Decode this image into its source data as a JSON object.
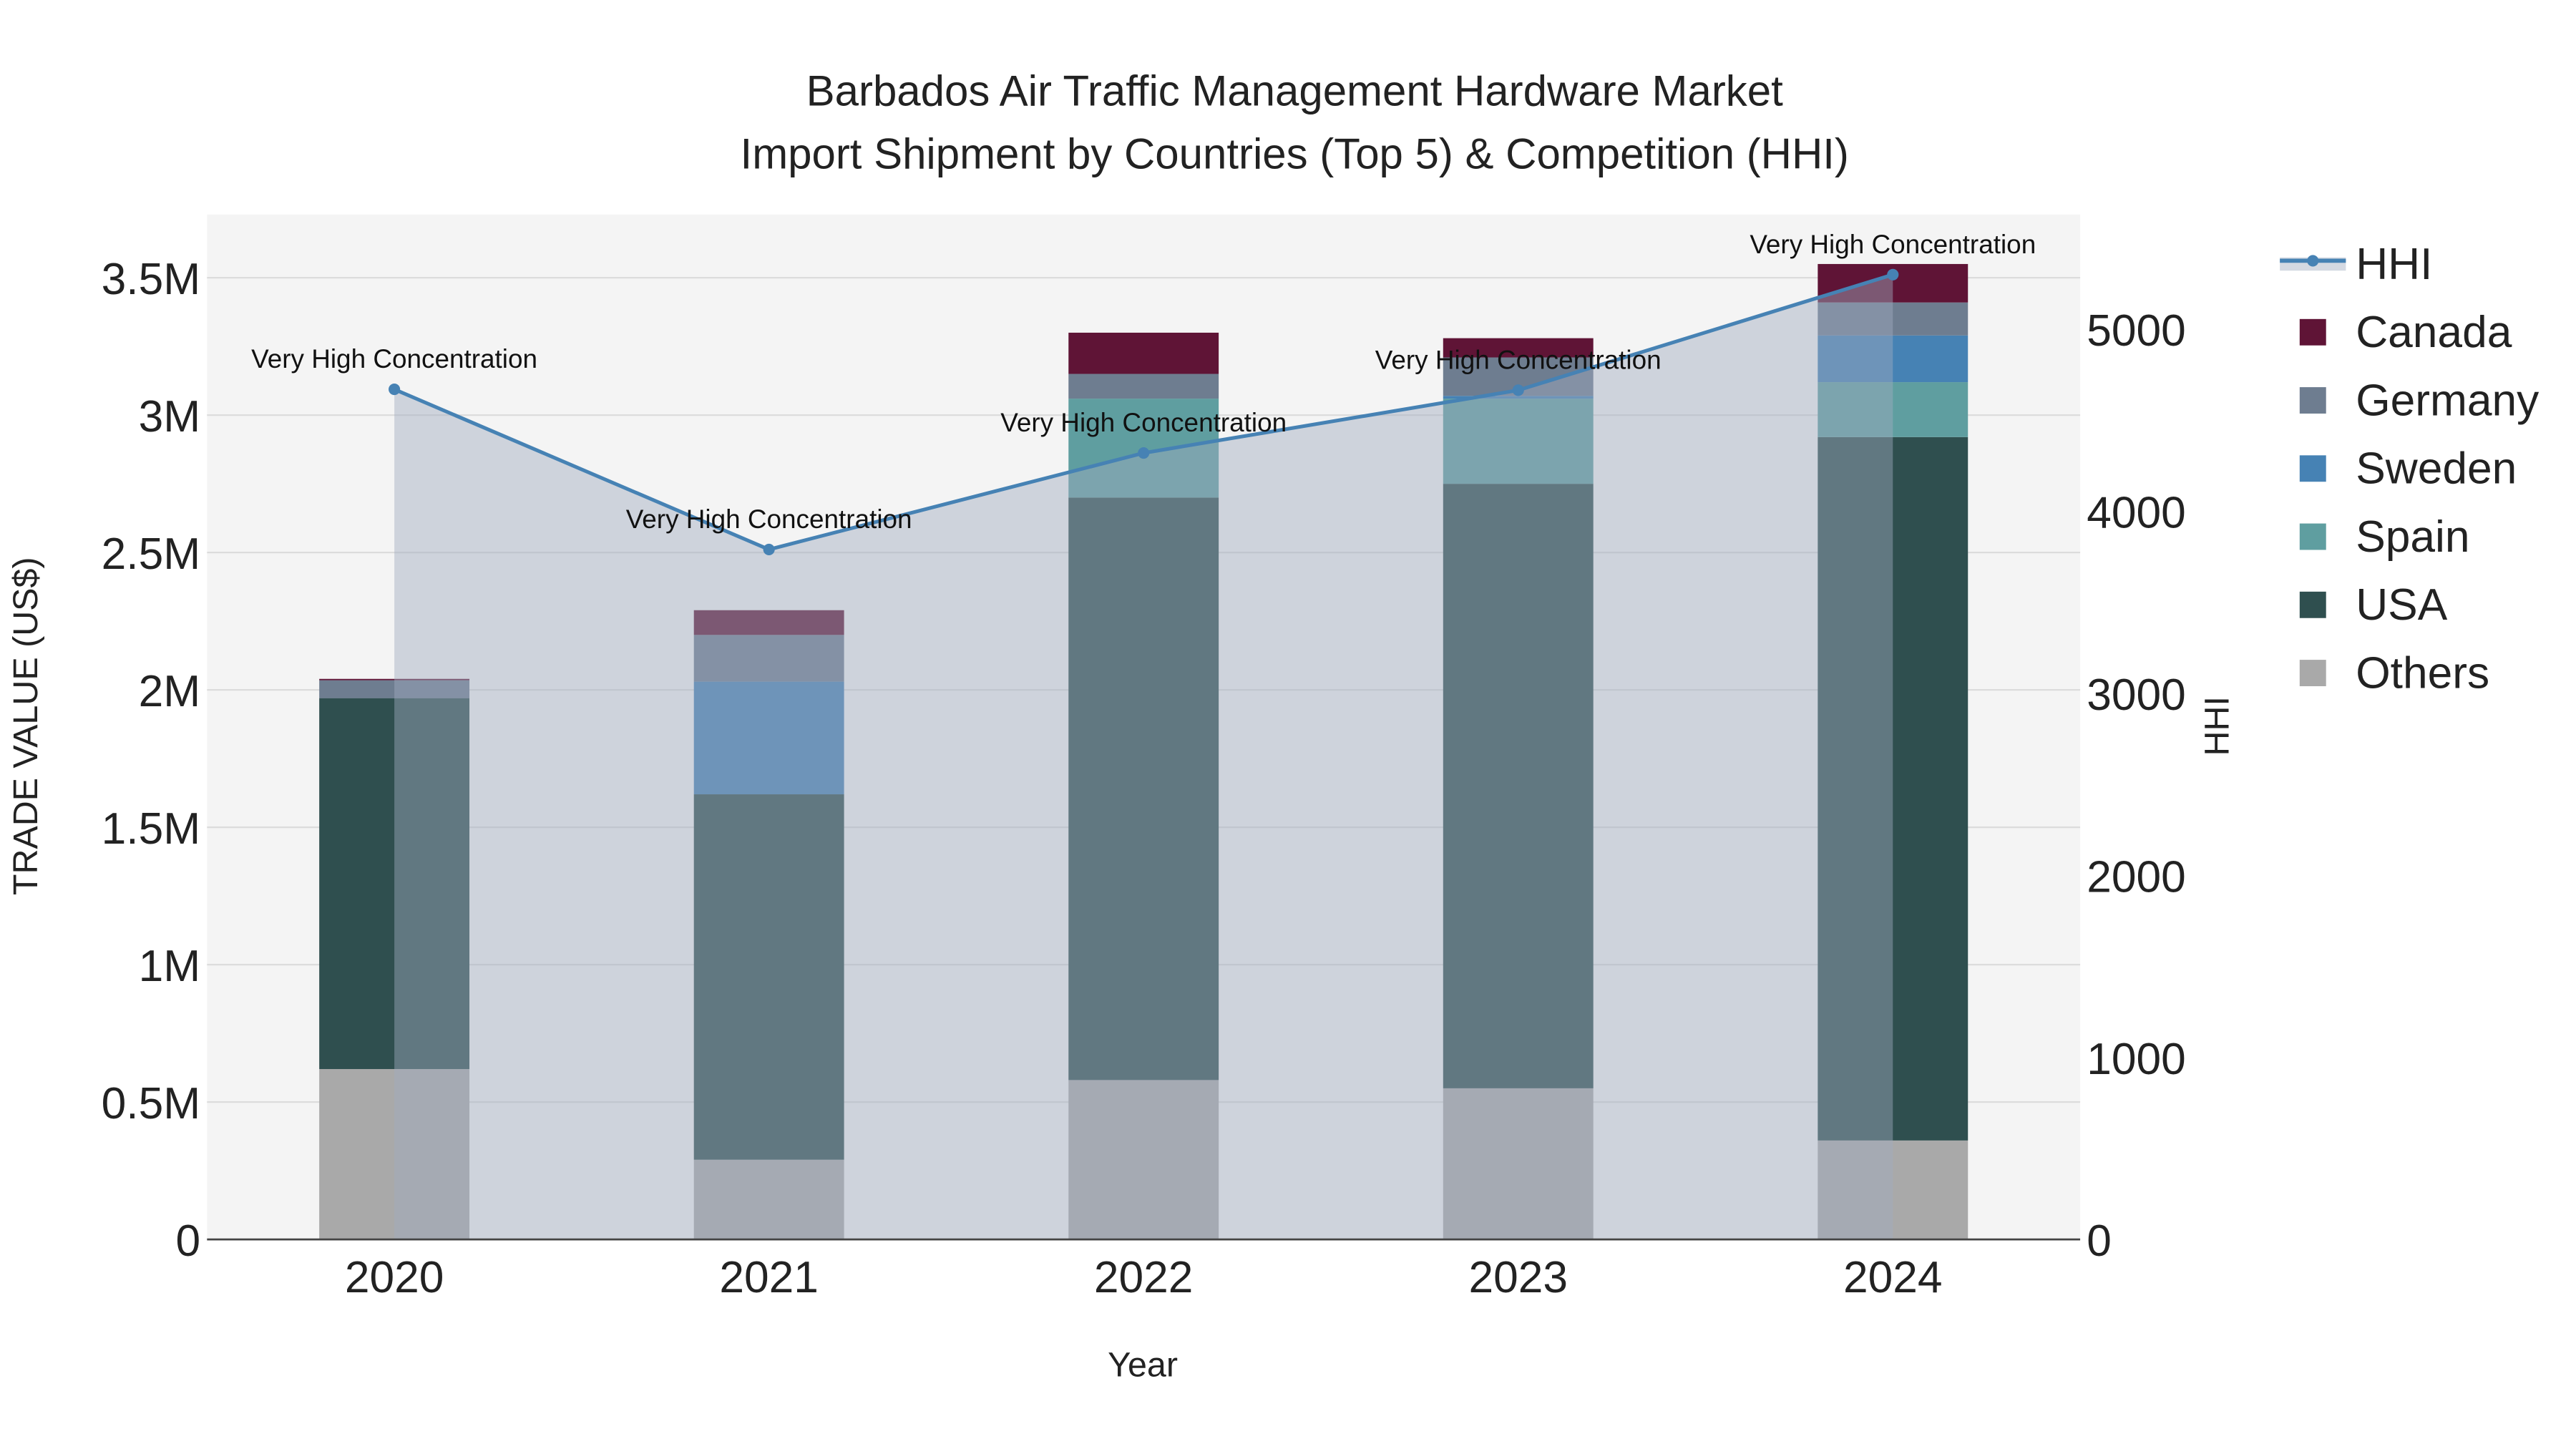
{
  "chart_data": {
    "type": "bar",
    "stacked": true,
    "title": [
      "Barbados Air Traffic Management Hardware Market",
      "Import Shipment by Countries (Top 5) & Competition (HHI)"
    ],
    "xlabel": "Year",
    "ylabel": "TRADE VALUE (US$)",
    "y2label": "HHI",
    "categories": [
      "2020",
      "2021",
      "2022",
      "2023",
      "2024"
    ],
    "ylim": [
      0,
      3730000
    ],
    "y2lim": [
      0,
      5630
    ],
    "yticks": [
      {
        "v": 0,
        "label": "0"
      },
      {
        "v": 500000,
        "label": "0.5M"
      },
      {
        "v": 1000000,
        "label": "1M"
      },
      {
        "v": 1500000,
        "label": "1.5M"
      },
      {
        "v": 2000000,
        "label": "2M"
      },
      {
        "v": 2500000,
        "label": "2.5M"
      },
      {
        "v": 3000000,
        "label": "3M"
      },
      {
        "v": 3500000,
        "label": "3.5M"
      }
    ],
    "y2ticks": [
      {
        "v": 0,
        "label": "0"
      },
      {
        "v": 1000,
        "label": "1000"
      },
      {
        "v": 2000,
        "label": "2000"
      },
      {
        "v": 3000,
        "label": "3000"
      },
      {
        "v": 4000,
        "label": "4000"
      },
      {
        "v": 5000,
        "label": "5000"
      }
    ],
    "series": [
      {
        "name": "Others",
        "color": "#a9a9a9",
        "values": [
          620000,
          290000,
          580000,
          550000,
          360000
        ]
      },
      {
        "name": "USA",
        "color": "#2f4f4f",
        "values": [
          1350000,
          1330000,
          2120000,
          2200000,
          2560000
        ]
      },
      {
        "name": "Spain",
        "color": "#5f9ea0",
        "values": [
          0,
          0,
          360000,
          310000,
          200000
        ]
      },
      {
        "name": "Sweden",
        "color": "#4682b4",
        "values": [
          0,
          410000,
          0,
          10000,
          170000
        ]
      },
      {
        "name": "Germany",
        "color": "#6e7d90",
        "values": [
          65000,
          170000,
          90000,
          140000,
          120000
        ]
      },
      {
        "name": "Canada",
        "color": "#5f1436",
        "values": [
          5000,
          90000,
          150000,
          70000,
          140000
        ]
      }
    ],
    "hhi": {
      "name": "HHI",
      "color": "#4682b4",
      "values": [
        4670,
        3790,
        4320,
        4665,
        5300
      ]
    },
    "annotations": [
      "Very High Concentration",
      "Very High Concentration",
      "Very High Concentration",
      "Very High Concentration",
      "Very High Concentration"
    ],
    "legend": [
      "HHI",
      "Canada",
      "Germany",
      "Sweden",
      "Spain",
      "USA",
      "Others"
    ],
    "legend_position": "right"
  }
}
